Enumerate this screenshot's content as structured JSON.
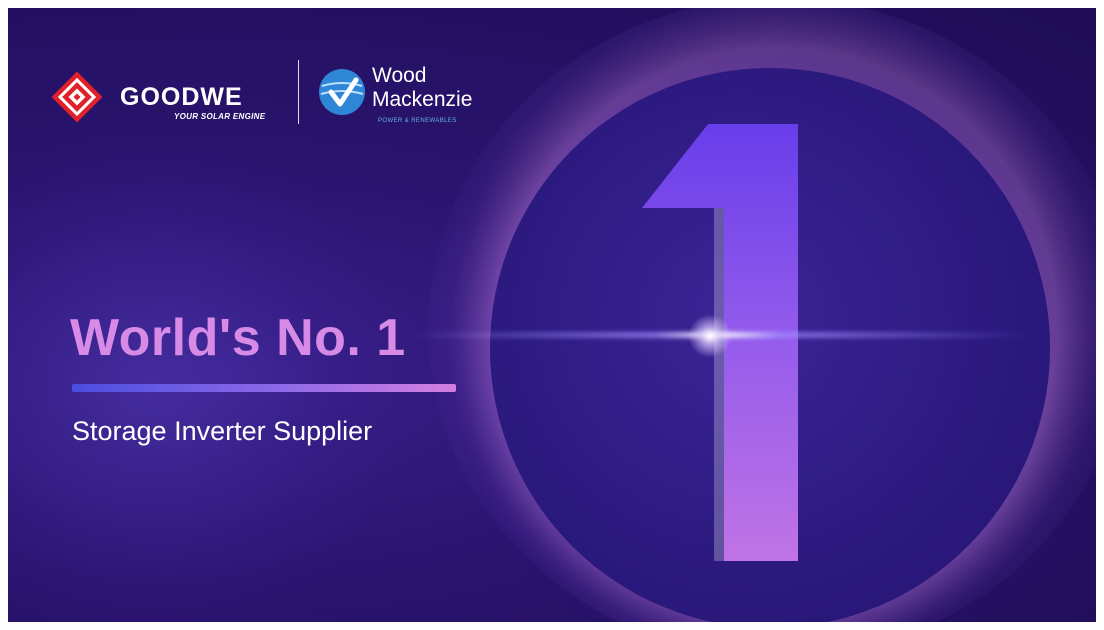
{
  "logos": {
    "goodwe_name": "GOODWE",
    "goodwe_tagline": "YOUR SOLAR ENGINE",
    "wood_mackenzie_line1": "Wood",
    "wood_mackenzie_line2": "Mackenzie",
    "wood_mackenzie_line3": "POWER & RENEWABLES"
  },
  "headline": {
    "title": "World's No. 1",
    "subtitle": "Storage Inverter Supplier",
    "big_numeral": "1"
  },
  "colors": {
    "background": "#2a1470",
    "headline": "#d78ae6",
    "goodwe_red": "#e0202a",
    "wood_mackenzie_blue": "#2f86d6"
  }
}
